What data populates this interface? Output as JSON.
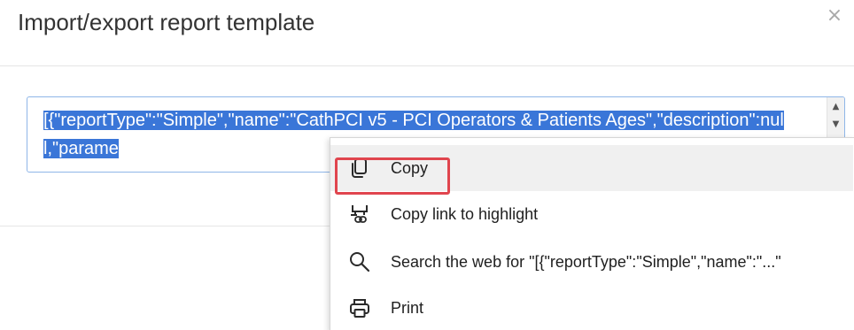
{
  "dialog": {
    "title": "Import/export report template",
    "close_glyph": "×"
  },
  "textarea": {
    "selected_text": "[{\"reportType\":\"Simple\",\"name\":\"CathPCI v5 - PCI Operators & Patients Ages\",\"description\":null,\"parame",
    "scroll_up_glyph": "▲",
    "scroll_down_glyph": "▼"
  },
  "context_menu": {
    "items": [
      {
        "label": "Copy",
        "icon": "copy-icon",
        "hovered": true,
        "highlighted": true
      },
      {
        "label": "Copy link to highlight",
        "icon": "link-highlight-icon"
      },
      {
        "label": "Search the web for \"[{\"reportType\":\"Simple\",\"name\":\"...\"",
        "icon": "search-icon"
      },
      {
        "label": "Print",
        "icon": "printer-icon"
      }
    ]
  },
  "colors": {
    "selection": "#3a76d8",
    "highlight_border": "#e0454e",
    "hover_bg": "#f0f0f0",
    "title_text": "#333333"
  }
}
